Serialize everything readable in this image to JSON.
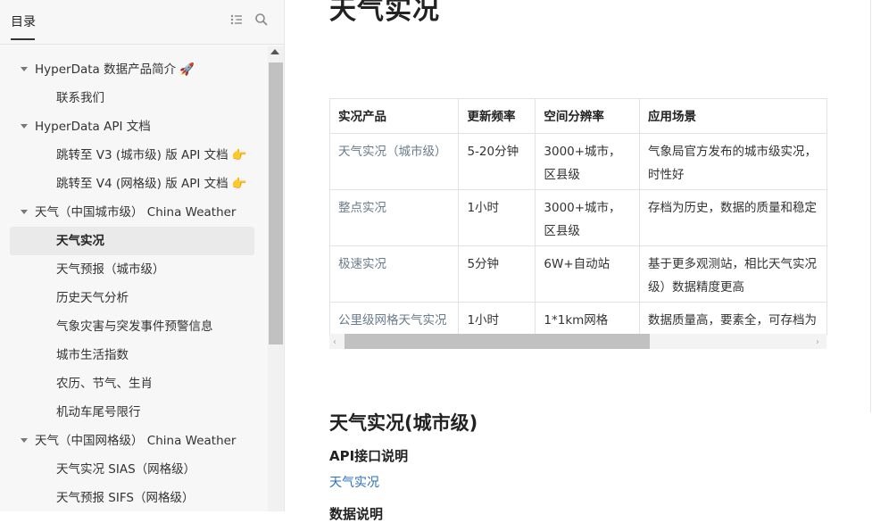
{
  "sidebar": {
    "title": "目录",
    "toc": [
      {
        "label": "HyperData 数据产品简介",
        "level": 1,
        "expanded": true,
        "emoji": "🚀"
      },
      {
        "label": "联系我们",
        "level": 2
      },
      {
        "label": "HyperData API 文档",
        "level": 1,
        "expanded": true
      },
      {
        "label": "跳转至 V3 (城市级) 版 API 文档",
        "level": 2,
        "emoji": "👉"
      },
      {
        "label": "跳转至 V4 (网格级) 版 API 文档",
        "level": 2,
        "emoji": "👉"
      },
      {
        "label": "天气（中国城市级） China Weather",
        "level": 1,
        "expanded": true
      },
      {
        "label": "天气实况",
        "level": 2,
        "active": true
      },
      {
        "label": "天气预报（城市级）",
        "level": 2
      },
      {
        "label": "历史天气分析",
        "level": 2
      },
      {
        "label": "气象灾害与突发事件预警信息",
        "level": 2
      },
      {
        "label": "城市生活指数",
        "level": 2
      },
      {
        "label": "农历、节气、生肖",
        "level": 2
      },
      {
        "label": "机动车尾号限行",
        "level": 2
      },
      {
        "label": "天气（中国网格级） China Weather",
        "level": 1,
        "expanded": true
      },
      {
        "label": "天气实况 SIAS（网格级）",
        "level": 2
      },
      {
        "label": "天气预报 SIFS（网格级）",
        "level": 2
      }
    ]
  },
  "main": {
    "title": "天气实况",
    "table": {
      "headers": [
        "实况产品",
        "更新频率",
        "空间分辨率",
        "应用场景"
      ],
      "rows": [
        [
          "天气实况（城市级）",
          "5-20分钟",
          "3000+城市，区县级",
          "气象局官方发布的城市级实况，时性好"
        ],
        [
          "整点实况",
          "1小时",
          "3000+城市，区县级",
          "存档为历史，数据的质量和稳定"
        ],
        [
          "极速实况",
          "5分钟",
          "6W+自动站",
          "基于更多观测站，相比天气实况级）数据精度更高"
        ],
        [
          "公里级网格天气实况",
          "1小时",
          "1*1km网格",
          "数据质量高，要素全，可存档为"
        ]
      ]
    },
    "section_title": "天气实况(城市级)",
    "api_heading": "API接口说明",
    "api_link": "天气实况",
    "data_heading": "数据说明"
  }
}
